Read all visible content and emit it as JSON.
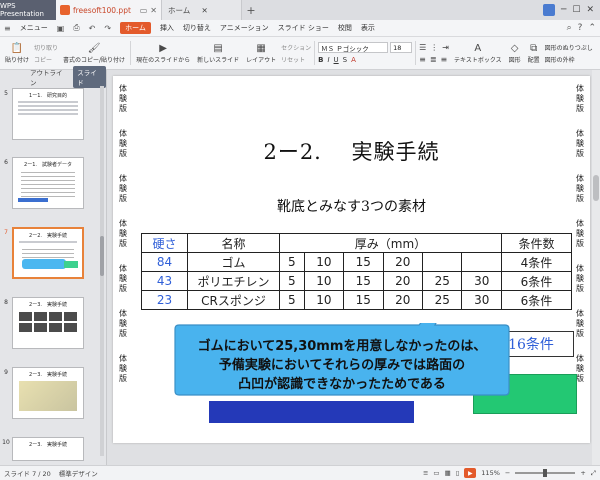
{
  "titlebar": {
    "app_tab": "WPS Presentation",
    "file_tab": "freesoft100.ppt",
    "home_tab": "ホーム",
    "new_tab": "+"
  },
  "menubar": {
    "menu_label": "メニュー",
    "items": [
      "ホーム",
      "挿入",
      "切り替え",
      "アニメーション",
      "スライド ショー",
      "校閲",
      "表示"
    ],
    "active": "ホーム"
  },
  "ribbon": {
    "cut": "切り取り",
    "copy": "コピー",
    "format_painter": "書式のコピー/貼り付け",
    "paste": "貼り付け",
    "from_current": "現在のスライドから",
    "new_slide": "新しいスライド",
    "layout": "レイアウト",
    "section": "セクション",
    "reset": "リセット",
    "font_name": "ＭＳ Ｐゴシック",
    "font_size": "18",
    "text_box": "テキストボックス",
    "shapes": "図形",
    "arrange": "配置",
    "shape_fill": "図形のぬりつぶし",
    "shape_outline": "図形の外枠"
  },
  "leftpanel": {
    "tab_outline": "アウトライン",
    "tab_slides": "スライド",
    "thumbs": [
      {
        "num": "5",
        "title": "1ー1.　研究目的"
      },
      {
        "num": "6",
        "title": "2ー1.　試験者データ"
      },
      {
        "num": "7",
        "title": "2ー2.　実験手続"
      },
      {
        "num": "8",
        "title": "2ー3.　実験手続"
      },
      {
        "num": "9",
        "title": "2ー3.　実験手続"
      },
      {
        "num": "10",
        "title": "2ー3.　実験手続"
      }
    ],
    "selected": "7"
  },
  "slide": {
    "side_text": [
      "体",
      "験",
      "版"
    ],
    "title": "2ー2.　 実験手続",
    "subtitle": "靴底とみなす3つの素材",
    "table": {
      "header": [
        "硬さ",
        "名称",
        "厚み（mm）",
        "条件数"
      ],
      "rows": [
        {
          "hardness": "84",
          "name": "ゴム",
          "thick": [
            "5",
            "10",
            "15",
            "20",
            "",
            ""
          ],
          "cond": "4条件"
        },
        {
          "hardness": "43",
          "name": "ポリエチレン",
          "thick": [
            "5",
            "10",
            "15",
            "20",
            "25",
            "30"
          ],
          "cond": "6条件"
        },
        {
          "hardness": "23",
          "name": "CRスポンジ",
          "thick": [
            "5",
            "10",
            "15",
            "20",
            "25",
            "30"
          ],
          "cond": "6条件"
        }
      ]
    },
    "total": "全16条件",
    "callout_lines": [
      "ゴムにおいて25,30mmを用意しなかったのは、",
      "予備実験においてそれらの厚みでは路面の",
      "凸凹が認識できなかったためである"
    ]
  },
  "statusbar": {
    "slide_info": "スライド 7 / 20",
    "design": "標準デザイン",
    "zoom": "115%"
  }
}
